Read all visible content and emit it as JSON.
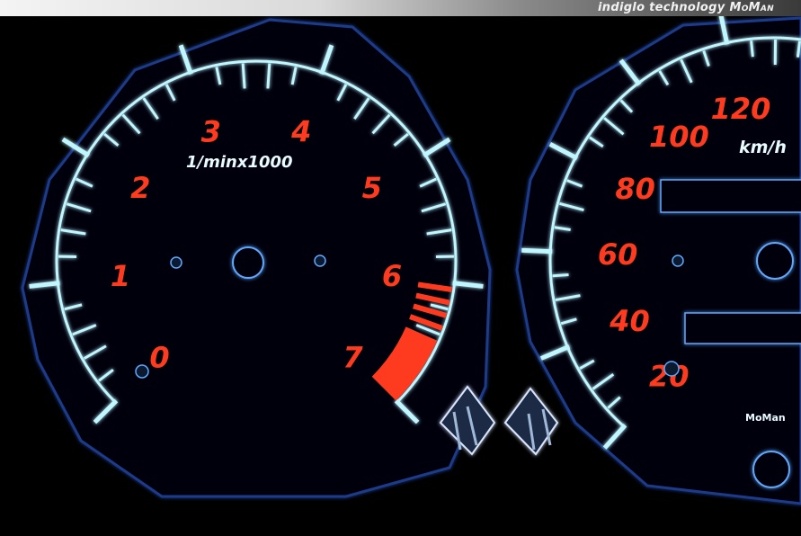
{
  "header": {
    "brand_text": "indiglo technology",
    "brand_name": "MoMan"
  },
  "tachometer": {
    "unit_label": "1/minx1000",
    "numbers": [
      "0",
      "1",
      "2",
      "3",
      "4",
      "5",
      "6",
      "7"
    ]
  },
  "speedometer": {
    "unit_label": "km/h",
    "numbers": [
      "20",
      "40",
      "60",
      "80",
      "100",
      "120"
    ],
    "logo": "MoMan"
  },
  "colors": {
    "glow": "#bff6ff",
    "numerals": "#ff3b1f",
    "redzone": "#ff3b1f",
    "background": "#000000"
  }
}
